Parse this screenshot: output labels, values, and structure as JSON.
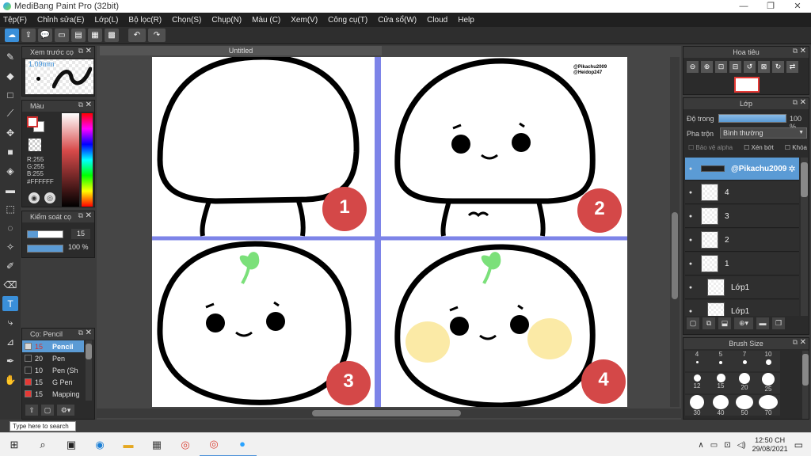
{
  "window": {
    "title": "MediBang Paint Pro (32bit)",
    "controls": [
      "—",
      "❐",
      "✕"
    ]
  },
  "menu": [
    "Tệp(F)",
    "Chỉnh sửa(E)",
    "Lớp(L)",
    "Bộ lọc(R)",
    "Chọn(S)",
    "Chụp(N)",
    "Màu (C)",
    "Xem(V)",
    "Công cụ(T)",
    "Cửa sổ(W)",
    "Cloud",
    "Help"
  ],
  "toolbar": {
    "icons": [
      "cloud-icon",
      "share-icon",
      "comment-icon",
      "message-icon",
      "document-icon",
      "grid-icon",
      "tiles-icon"
    ],
    "undo_icon": "undo-icon",
    "redo_icon": "redo-icon"
  },
  "panels": {
    "preview": {
      "title": "Xem trước cọ",
      "size": "1.09mm"
    },
    "color": {
      "title": "Màu",
      "r": "R:255",
      "g": "G:255",
      "b": "B:255",
      "hex": "#FFFFFF",
      "fg": "#ffffff",
      "bg": "#ffffff"
    },
    "brush_control": {
      "title": "Kiểm soát cọ",
      "size": "15",
      "opacity": "100 %"
    },
    "brush_list": {
      "title": "Cọ: Pencil",
      "items": [
        {
          "size": "15",
          "name": "Pencil",
          "color": "#d8d8d8"
        },
        {
          "size": "20",
          "name": "Pen",
          "color": "#2a2a2a"
        },
        {
          "size": "10",
          "name": "Pen (Sh",
          "color": "#2a2a2a"
        },
        {
          "size": "15",
          "name": "G Pen",
          "color": "#e53935"
        },
        {
          "size": "15",
          "name": "Mapping",
          "color": "#e53935"
        }
      ]
    },
    "navigator": {
      "title": "Hoa tiêu"
    },
    "layer": {
      "title": "Lớp",
      "opacity_label": "Độ trong",
      "opacity_value": "100 %",
      "blend_label": "Pha trộn",
      "blend_value": "Bình thường",
      "protect_alpha": "Bảo vệ alpha",
      "clip": "Xén bớt",
      "lock": "Khóa",
      "layers": [
        {
          "name": "@Pikachu2009",
          "selected": true
        },
        {
          "name": "4",
          "selected": false
        },
        {
          "name": "3",
          "selected": false
        },
        {
          "name": "2",
          "selected": false
        },
        {
          "name": "1",
          "selected": false
        },
        {
          "name": "Lớp1",
          "selected": false
        },
        {
          "name": "Lớp1",
          "selected": false
        }
      ]
    },
    "brush_size": {
      "title": "Brush Size",
      "labels": [
        "4",
        "5",
        "7",
        "10",
        "12",
        "15",
        "20",
        "25",
        "30",
        "40",
        "50",
        "70"
      ]
    }
  },
  "document": {
    "tab": "Untitled",
    "watermark_1": "@Pikachu2009",
    "watermark_2": "@Heidop247",
    "badges": [
      "1",
      "2",
      "3",
      "4"
    ]
  },
  "tooltip": "Type here to search",
  "taskbar": {
    "icons": [
      "windows-icon",
      "search-icon",
      "taskview-icon",
      "edge-icon",
      "explorer-icon",
      "store-icon",
      "chrome-icon",
      "chrome-profile-icon",
      "medibang-icon"
    ],
    "time": "12:50 CH",
    "date": "29/08/2021"
  }
}
